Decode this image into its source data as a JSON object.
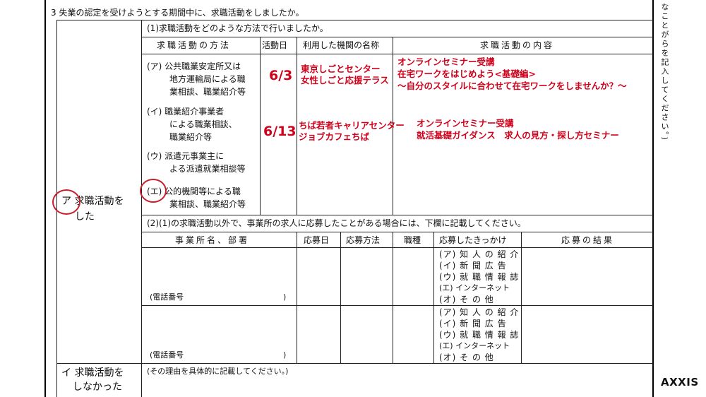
{
  "form": {
    "section_title": "3 失業の認定を受けようとする期間中に、求職活動をしましたか。",
    "q1": "(1)求職活動をどのような方法で行いましたか。",
    "headers": {
      "method": "求職活動の方法",
      "date": "活動日",
      "institution": "利用した機関の名称",
      "content": "求職活動の内容"
    },
    "methods": [
      {
        "l1": "(ア) 公共職業安定所又は",
        "l2": "地方運輸局による職",
        "l3": "業相談、職業紹介等"
      },
      {
        "l1": "(イ) 職業紹介事業者",
        "l2": "による職業相談、",
        "l3": "職業紹介等"
      },
      {
        "l1": "(ウ) 派遣元事業主に",
        "l2": "よる派遣就業相談等"
      },
      {
        "l1": "(エ) 公的機関等による職",
        "l2": "業相談、職業紹介等"
      }
    ],
    "left_a_line1": "ア 求職活動を",
    "left_a_line2": "した",
    "q2": "(2)(1)の求職活動以外で、事業所の求人に応募したことがある場合には、下欄に記載してください。",
    "headers2": {
      "company": "事業所名、部署",
      "apply_date": "応募日",
      "apply_method": "応募方法",
      "job": "職種",
      "trigger": "応募したきっかけ",
      "result": "応募の結果"
    },
    "phone_label": "(電話番号",
    "phone_close": ")",
    "trigger_options": [
      "(ア) 知 人 の 紹 介",
      "(イ) 新 聞 広 告",
      "(ウ) 就 職 情 報 誌",
      "(エ) インターネット",
      "(オ) そ の 他"
    ],
    "left_i_line1": "イ 求職活動を",
    "left_i_line2": "しなかった",
    "reason_prompt": "(その理由を具体的に記載してください。)",
    "side_note": "なことがらを記入してください。)"
  },
  "entries": [
    {
      "date": "6/3",
      "inst1": "東京しごとセンター",
      "inst2": "女性しごと応援テラス",
      "c1": "オンラインセミナー受講",
      "c2": "在宅ワークをはじめよう<基礎編>",
      "c3": "〜自分のスタイルに合わせて在宅ワークをしませんか？〜"
    },
    {
      "date": "6/13",
      "inst1": "ちば若者キャリアセンター",
      "inst2": "ジョブカフェちば",
      "c1": "オンラインセミナー受講",
      "c2": "就活基礎ガイダンス　求人の見方・探し方セミナー"
    }
  ],
  "brand": {
    "logo": "AXXIS"
  },
  "colors": {
    "annotation": "#d0021b",
    "circle": "#c81e2c"
  }
}
